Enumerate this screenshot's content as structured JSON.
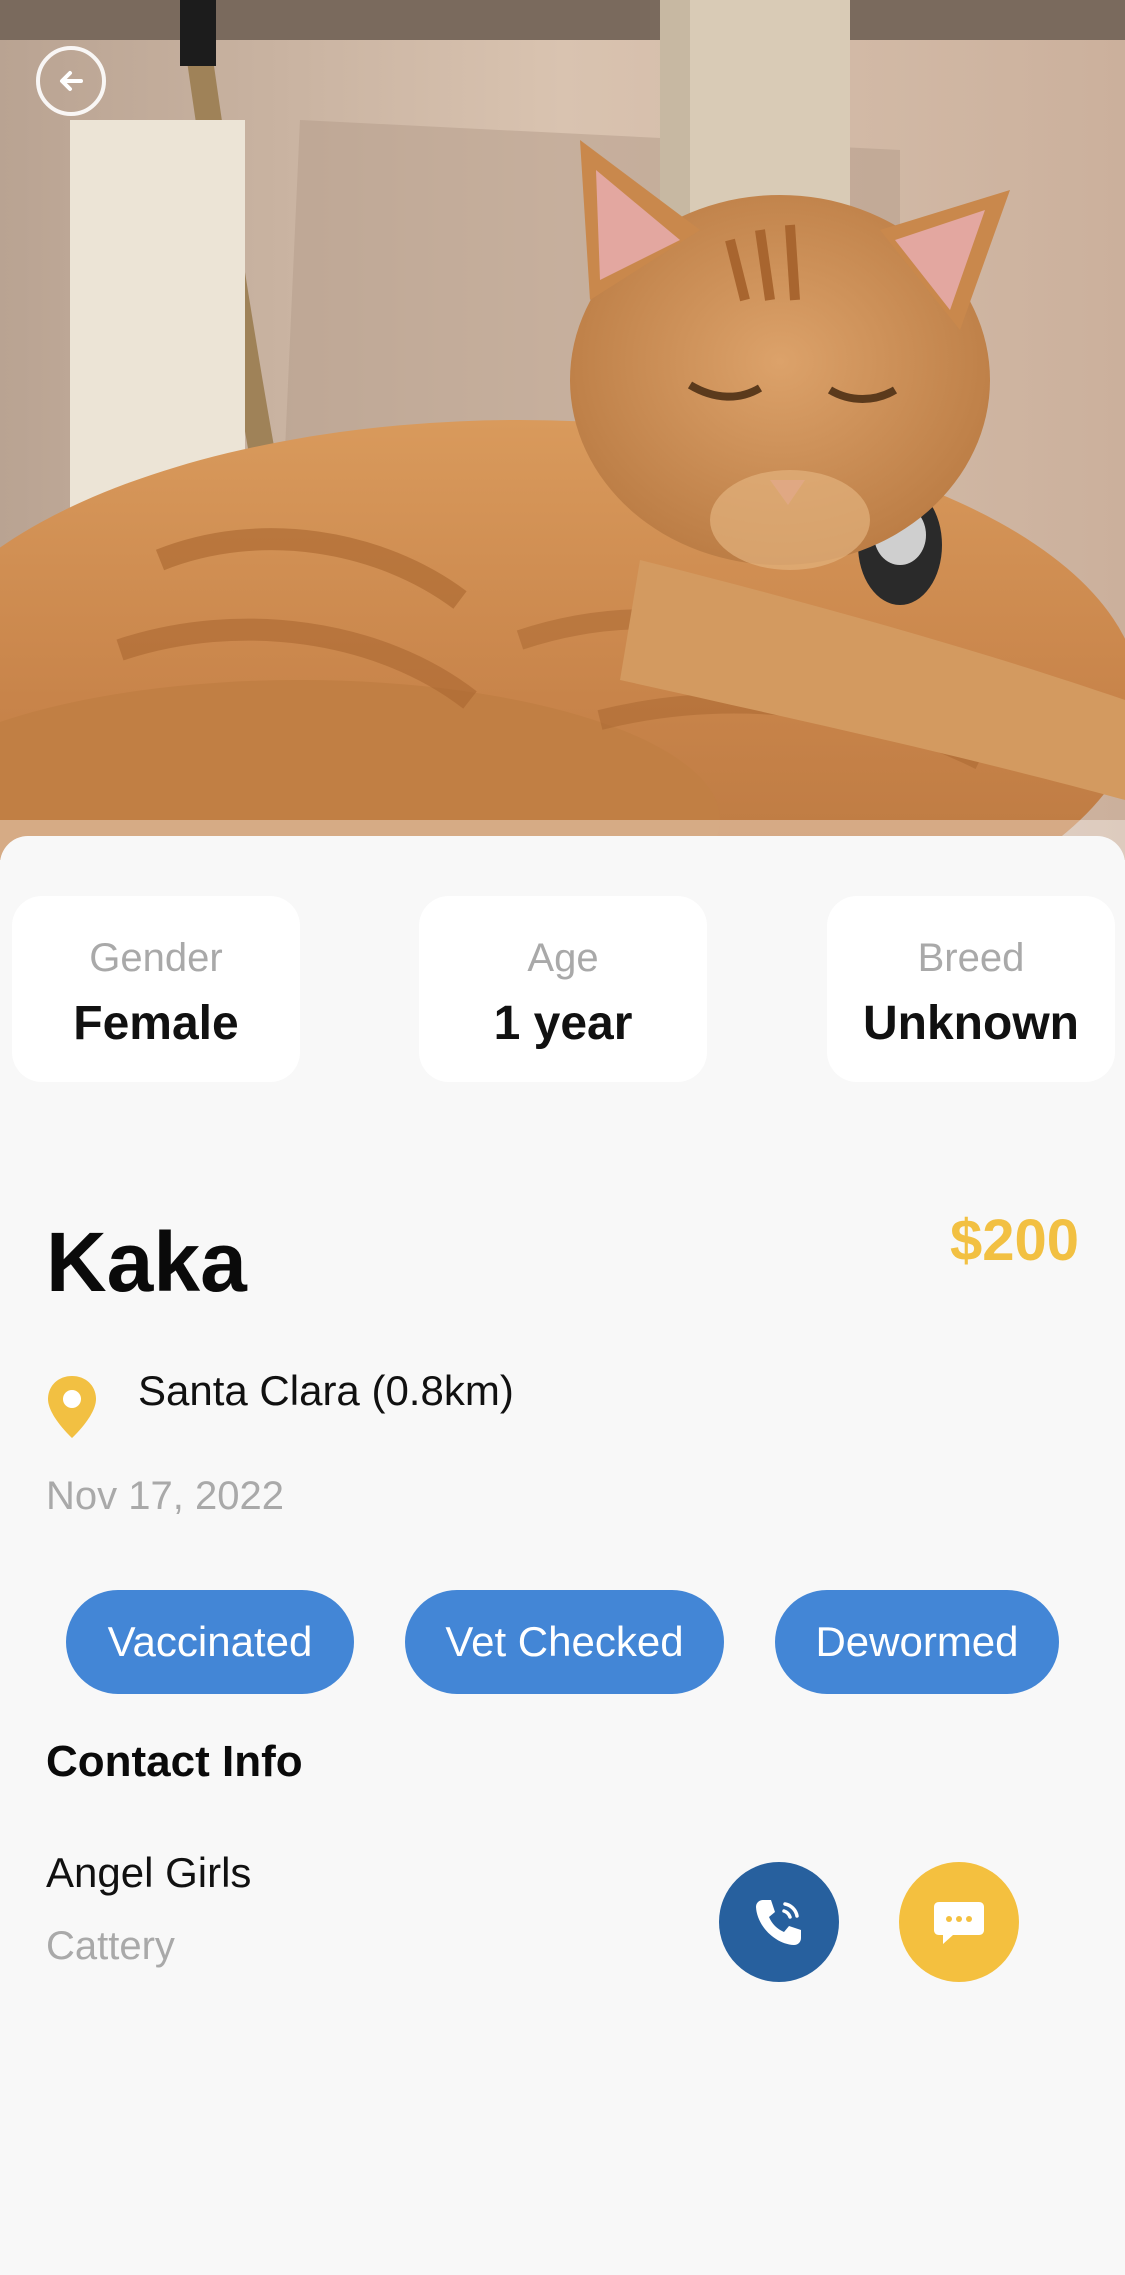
{
  "header": {
    "back_icon": "back-arrow-icon",
    "photo_alt": "orange tabby cat lying on a cat tree"
  },
  "stats": [
    {
      "label": "Gender",
      "value": "Female"
    },
    {
      "label": "Age",
      "value": "1 year"
    },
    {
      "label": "Breed",
      "value": "Unknown"
    }
  ],
  "pet": {
    "name": "Kaka",
    "price": "$200",
    "location": "Santa Clara (0.8km)",
    "location_icon": "map-pin-icon",
    "date": "Nov 17, 2022"
  },
  "tags": [
    "Vaccinated",
    "Vet Checked",
    "Dewormed"
  ],
  "contact": {
    "title": "Contact Info",
    "name": "Angel Girls",
    "type": "Cattery",
    "call_icon": "phone-icon",
    "message_icon": "chat-bubble-icon"
  },
  "colors": {
    "accent_yellow": "#f2c042",
    "tag_blue": "#4386d6",
    "call_blue": "#27609e",
    "background": "#f8f8f8"
  }
}
